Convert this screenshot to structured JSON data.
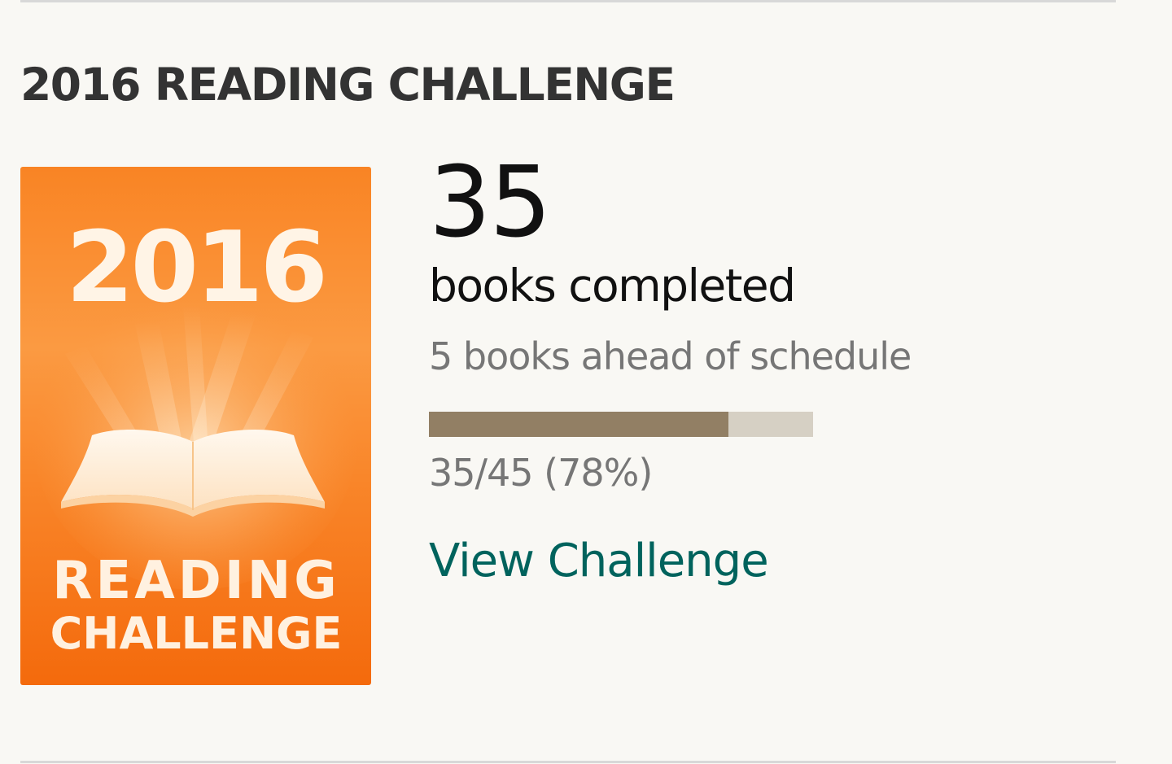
{
  "challenge": {
    "heading": "2016 READING CHALLENGE",
    "badge": {
      "year": "2016",
      "line1": "READING",
      "line2": "CHALLENGE",
      "colors": {
        "orange_light": "#fba24e",
        "orange_dark": "#f56a0c"
      }
    },
    "books_completed": "35",
    "books_completed_label": "books completed",
    "schedule_status": "5 books ahead of schedule",
    "progress": {
      "fraction": 0.78,
      "text": "35/45 (78%)",
      "fill_color": "#927f64",
      "track_color": "#d6d0c4"
    },
    "view_link_label": "View Challenge",
    "link_color": "#00635d"
  }
}
